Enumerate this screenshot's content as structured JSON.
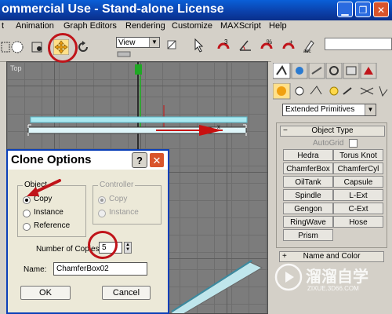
{
  "window": {
    "title": "ommercial Use - Stand-alone License"
  },
  "menus": [
    "t",
    "Animation",
    "Graph Editors",
    "Rendering",
    "Customize",
    "MAXScript",
    "Help"
  ],
  "toolbar": {
    "view_select": "View"
  },
  "viewport": {
    "label": "Top"
  },
  "cmdpanel": {
    "dropdown": "Extended Primitives",
    "object_type_header": "Object Type",
    "autogrid": "AutoGrid",
    "buttons": [
      "Hedra",
      "Torus Knot",
      "ChamferBox",
      "ChamferCyl",
      "OilTank",
      "Capsule",
      "Spindle",
      "L-Ext",
      "Gengon",
      "C-Ext",
      "RingWave",
      "Hose",
      "Prism"
    ],
    "name_color_header": "Name and Color"
  },
  "dialog": {
    "title": "Clone Options",
    "help_label": "?",
    "object_group": "Object",
    "controller_group": "Controller",
    "object_options": [
      "Copy",
      "Instance",
      "Reference"
    ],
    "controller_options": [
      "Copy",
      "Instance"
    ],
    "copies_label": "Number of Copies:",
    "copies_value": "5",
    "name_label": "Name:",
    "name_value": "ChamferBox02",
    "ok_label": "OK",
    "cancel_label": "Cancel"
  },
  "watermark": {
    "brand": "溜溜自学",
    "url": "ZIXUE.3D66.COM"
  },
  "colors": {
    "title_blue": "#0b3fa8",
    "highlight_red": "#c0141a",
    "object_cyan": "#9fe0ea"
  }
}
